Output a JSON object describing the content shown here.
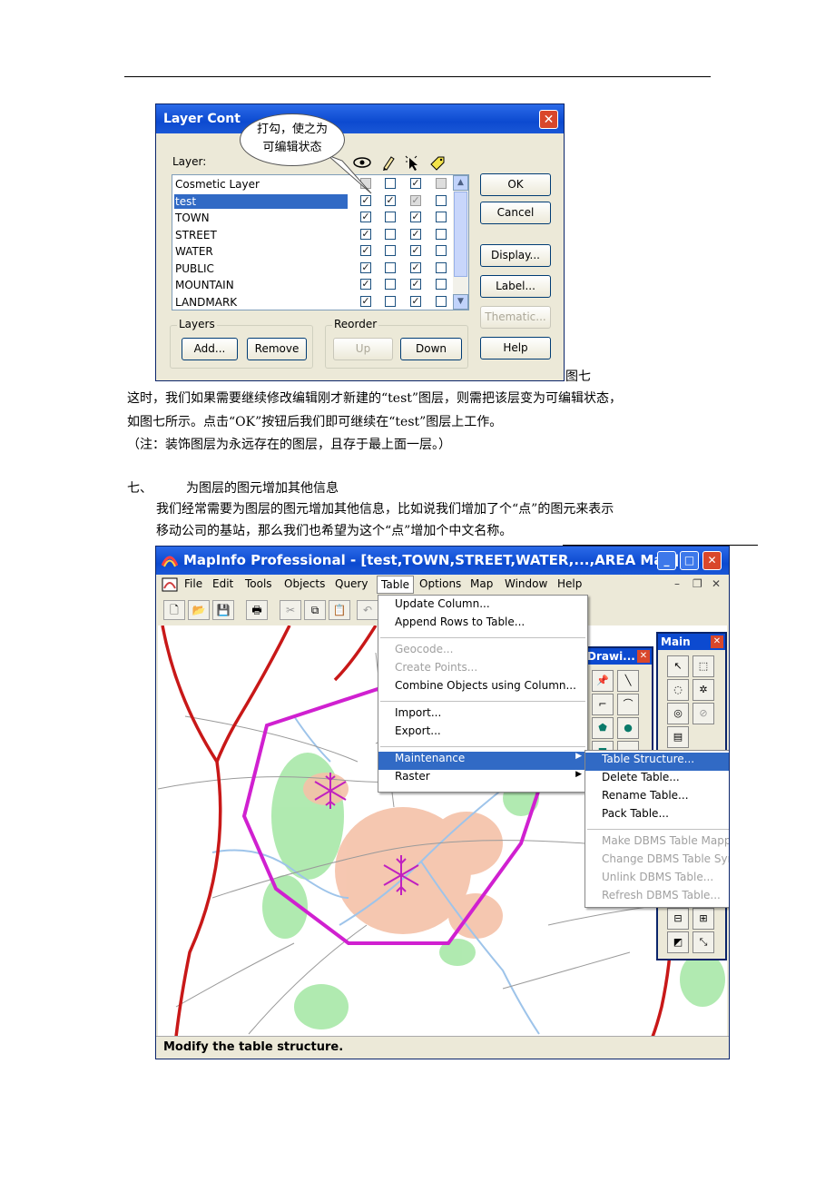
{
  "caption": "图七",
  "para1": "这时，我们如果需要继续修改编辑刚才新建的“test”图层，则需把该层变为可编辑状态，",
  "para2": "如图七所示。点击“OK”按钮后我们即可继续在“test”图层上工作。",
  "para3": "（注：装饰图层为永远存在的图层，且存于最上面一层。）",
  "section_num": "七、",
  "section_title": "为图层的图元增加其他信息",
  "para4": "我们经常需要为图层的图元增加其他信息，比如说我们增加了个“点”的图元来表示",
  "para5": "移动公司的基站，那么我们也希望为这个“点”增加个中文名称。",
  "layer_control": {
    "title": "Layer Cont",
    "close": "✕",
    "callout_line1": "打勾，使之为",
    "callout_line2": "可编辑状态",
    "layer_label": "Layer:",
    "layers": [
      {
        "name": "Cosmetic Layer",
        "visible": false,
        "editable": false,
        "selectable": true,
        "autolabel": false,
        "selected": false
      },
      {
        "name": "test",
        "visible": true,
        "editable": true,
        "selectable": true,
        "autolabel": false,
        "selected": true
      },
      {
        "name": "TOWN",
        "visible": true,
        "editable": false,
        "selectable": true,
        "autolabel": false,
        "selected": false
      },
      {
        "name": "STREET",
        "visible": true,
        "editable": false,
        "selectable": true,
        "autolabel": false,
        "selected": false
      },
      {
        "name": "WATER",
        "visible": true,
        "editable": false,
        "selectable": true,
        "autolabel": false,
        "selected": false
      },
      {
        "name": "PUBLIC",
        "visible": true,
        "editable": false,
        "selectable": true,
        "autolabel": false,
        "selected": false
      },
      {
        "name": "MOUNTAIN",
        "visible": true,
        "editable": false,
        "selectable": true,
        "autolabel": false,
        "selected": false
      },
      {
        "name": "LANDMARK",
        "visible": true,
        "editable": false,
        "selectable": true,
        "autolabel": false,
        "selected": false
      }
    ],
    "ok": "OK",
    "cancel": "Cancel",
    "display": "Display...",
    "label": "Label...",
    "thematic": "Thematic...",
    "help": "Help",
    "layers_group": "Layers",
    "add": "Add...",
    "remove": "Remove",
    "reorder_group": "Reorder",
    "up": "Up",
    "down": "Down"
  },
  "mapinfo": {
    "title": "MapInfo Professional - [test,TOWN,STREET,WATER,...,AREA Map]",
    "menu": [
      "File",
      "Edit",
      "Tools",
      "Objects",
      "Query",
      "Table",
      "Options",
      "Map",
      "Window",
      "Help"
    ],
    "table_menu": {
      "group1": [
        "Update Column...",
        "Append Rows to Table..."
      ],
      "group2_disabled": [
        "Geocode...",
        "Create Points..."
      ],
      "group2": "Combine Objects using Column...",
      "group3": [
        "Import...",
        "Export..."
      ],
      "maintenance": "Maintenance",
      "raster": "Raster"
    },
    "maintenance_menu": {
      "items": [
        "Table Structure...",
        "Delete Table...",
        "Rename Table...",
        "Pack Table..."
      ],
      "disabled": [
        "Make DBMS Table Mappable...",
        "Change DBMS Table Symbol...",
        "Unlink DBMS Table...",
        "Refresh DBMS Table..."
      ]
    },
    "drawing_palette": "Drawi...",
    "main_palette": "Main",
    "status": "Modify the table structure."
  }
}
